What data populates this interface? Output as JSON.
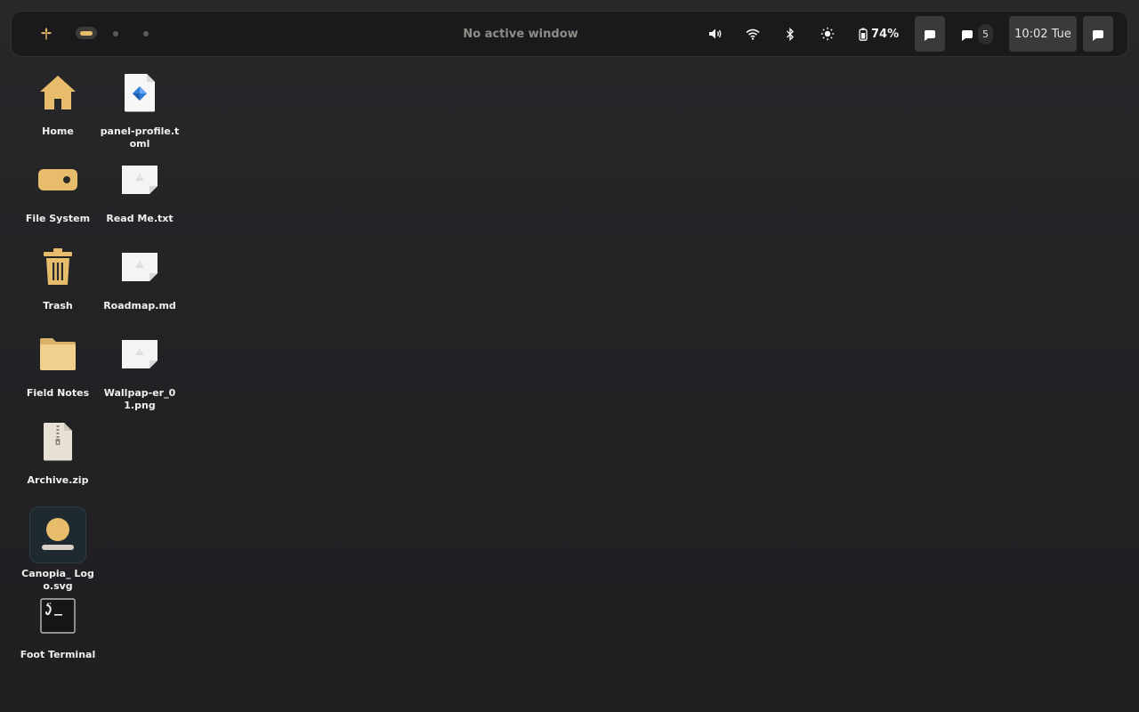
{
  "topbar": {
    "launcher_icon": "canopia-leaf-icon",
    "window_title": "No active window",
    "battery_percent": "74%",
    "notification_count": "5",
    "clock": "10:02 Tue"
  },
  "colors": {
    "accent": "#e7bd6c",
    "panel_bg": "#1a1a1c",
    "desktop_bg": "#232326",
    "button_bg": "#3a3a3c"
  },
  "desktop": {
    "icons": [
      {
        "label": "Home",
        "icon": "home-folder-icon"
      },
      {
        "label": "panel-profile.toml",
        "icon": "toml-file-icon"
      },
      {
        "label": "File System",
        "icon": "drive-icon"
      },
      {
        "label": "Read Me.txt",
        "icon": "text-file-icon"
      },
      {
        "label": "Trash",
        "icon": "trash-icon"
      },
      {
        "label": "Roadmap.md",
        "icon": "markdown-file-icon"
      },
      {
        "label": "Field Notes",
        "icon": "folder-icon"
      },
      {
        "label": "Wallpap-er_01.png",
        "icon": "image-file-icon"
      },
      {
        "label": "Archive.zip",
        "icon": "zip-file-icon"
      },
      {
        "label": "Canopia_ Logo.svg",
        "icon": "svg-file-icon"
      },
      {
        "label": "Foot Terminal",
        "icon": "terminal-icon"
      }
    ]
  }
}
